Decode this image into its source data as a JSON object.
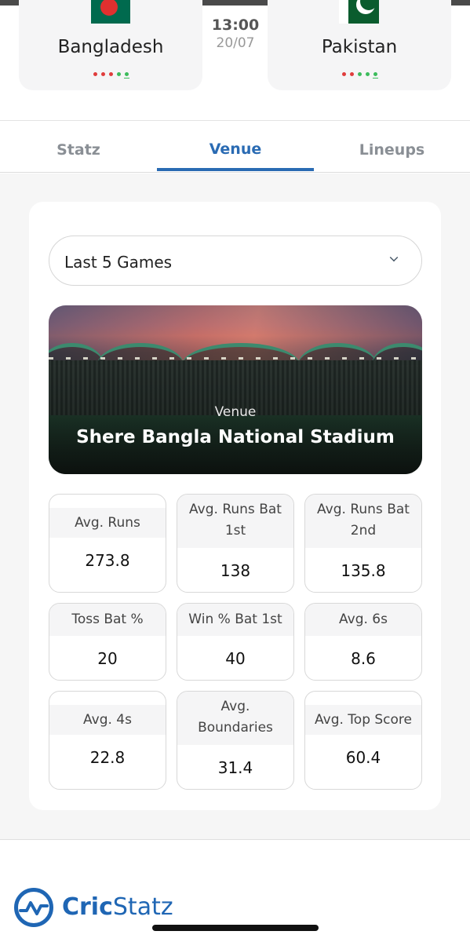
{
  "match": {
    "home_team": "Bangladesh",
    "away_team": "Pakistan",
    "time": "13:00",
    "date": "20/07",
    "home_form": [
      "L",
      "L",
      "L",
      "W",
      "W"
    ],
    "away_form": [
      "L",
      "L",
      "W",
      "W",
      "W"
    ]
  },
  "tabs": [
    {
      "label": "Statz",
      "active": false
    },
    {
      "label": "Venue",
      "active": true
    },
    {
      "label": "Lineups",
      "active": false
    }
  ],
  "filter": {
    "selected": "Last 5 Games"
  },
  "venue": {
    "caption": "Venue",
    "name": "Shere Bangla National Stadium"
  },
  "stats": [
    {
      "label": "Avg. Runs",
      "value": "273.8"
    },
    {
      "label": "Avg. Runs Bat 1st",
      "value": "138"
    },
    {
      "label": "Avg. Runs Bat 2nd",
      "value": "135.8"
    },
    {
      "label": "Toss Bat %",
      "value": "20"
    },
    {
      "label": "Win % Bat 1st",
      "value": "40"
    },
    {
      "label": "Avg. 6s",
      "value": "8.6"
    },
    {
      "label": "Avg. 4s",
      "value": "22.8"
    },
    {
      "label": "Avg. Boundaries",
      "value": "31.4"
    },
    {
      "label": "Avg. Top Score",
      "value": "60.4"
    }
  ],
  "brand": {
    "name_bold": "Cric",
    "name_regular": "Statz",
    "color": "#1f66b4"
  },
  "colors": {
    "accent": "#2a6bb3",
    "loss": "#e03c3c",
    "win": "#3cbc5c"
  }
}
